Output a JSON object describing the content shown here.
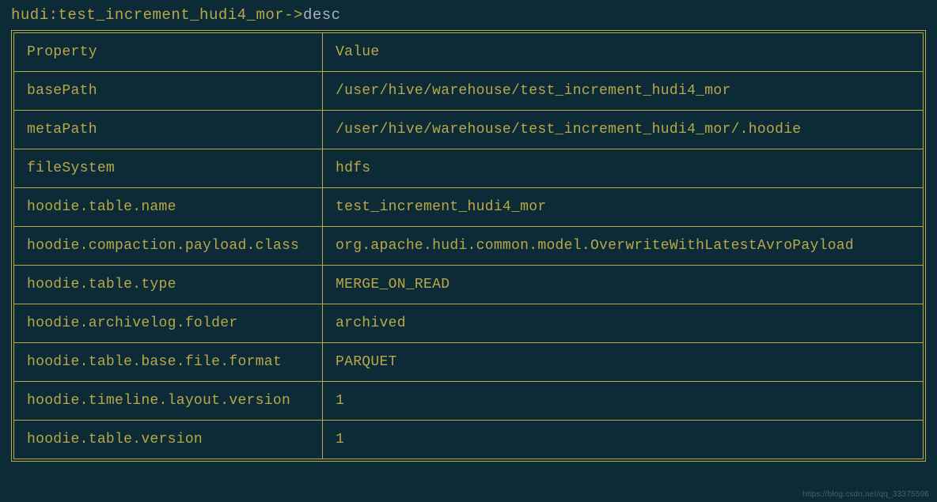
{
  "prompt": {
    "prefix": "hudi:test_increment_hudi4_mor->",
    "command": "desc"
  },
  "table": {
    "headers": {
      "col1": "Property",
      "col2": "Value"
    },
    "rows": [
      {
        "property": "basePath",
        "value": "/user/hive/warehouse/test_increment_hudi4_mor"
      },
      {
        "property": "metaPath",
        "value": "/user/hive/warehouse/test_increment_hudi4_mor/.hoodie"
      },
      {
        "property": "fileSystem",
        "value": "hdfs"
      },
      {
        "property": "hoodie.table.name",
        "value": "test_increment_hudi4_mor"
      },
      {
        "property": "hoodie.compaction.payload.class",
        "value": "org.apache.hudi.common.model.OverwriteWithLatestAvroPayload"
      },
      {
        "property": "hoodie.table.type",
        "value": "MERGE_ON_READ"
      },
      {
        "property": "hoodie.archivelog.folder",
        "value": "archived"
      },
      {
        "property": "hoodie.table.base.file.format",
        "value": "PARQUET"
      },
      {
        "property": "hoodie.timeline.layout.version",
        "value": "1"
      },
      {
        "property": "hoodie.table.version",
        "value": "1"
      }
    ]
  },
  "watermark": "https://blog.csdn.net/qq_33375596"
}
